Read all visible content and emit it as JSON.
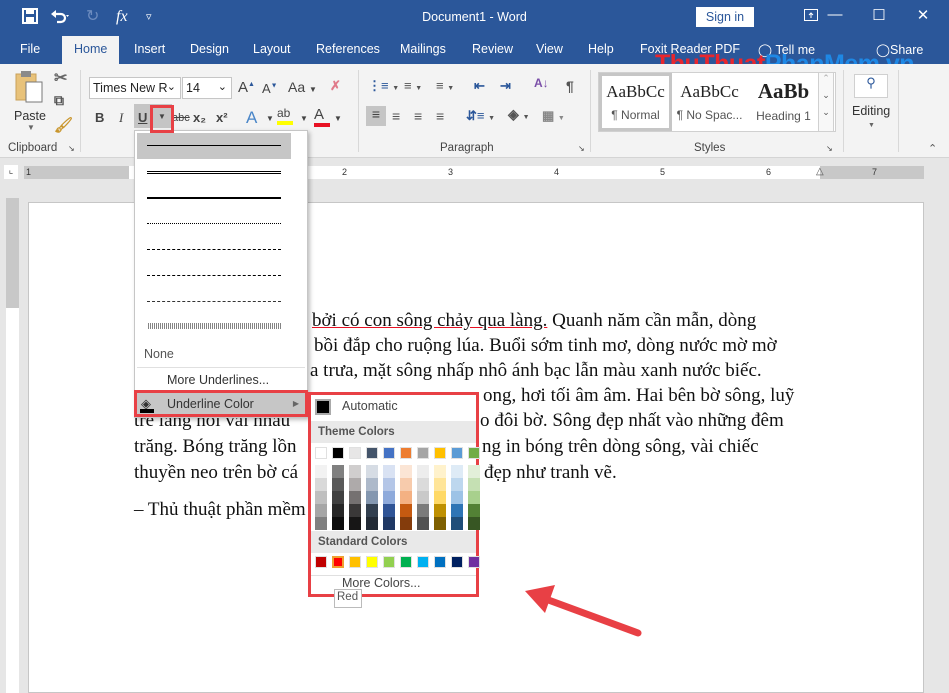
{
  "window": {
    "title": "Document1  -  Word",
    "sign_in": "Sign in"
  },
  "qat": {
    "save_icon": "save-icon",
    "undo_icon": "undo-icon",
    "redo_icon": "redo-icon",
    "formula_icon": "fx",
    "customize_icon": "customize-icon"
  },
  "tabs": [
    "File",
    "Home",
    "Insert",
    "Design",
    "Layout",
    "References",
    "Mailings",
    "Review",
    "View",
    "Help",
    "Foxit Reader PDF",
    "Tell me",
    "Share"
  ],
  "active_tab": "Home",
  "ribbon": {
    "clipboard": {
      "label": "Clipboard",
      "paste": "Paste"
    },
    "font": {
      "name": "Times New R",
      "size": "14",
      "grow": "A",
      "shrink": "A",
      "case": "Aa",
      "bold": "B",
      "italic": "I",
      "underline": "U",
      "strike": "abc",
      "subscript": "x₂",
      "superscript": "x²",
      "effects": "A",
      "highlight": "ab",
      "font_color": "A",
      "highlight_color": "#ffff00",
      "font_color_value": "#e81123"
    },
    "paragraph": {
      "label": "Paragraph",
      "show_marks": "¶"
    },
    "styles": {
      "label": "Styles",
      "items": [
        {
          "preview": "AaBbCc",
          "name": "¶ Normal"
        },
        {
          "preview": "AaBbCc",
          "name": "¶ No Spac..."
        },
        {
          "preview": "AaBb",
          "name": "Heading 1"
        }
      ]
    },
    "editing": {
      "label": "Editing"
    }
  },
  "ruler": {
    "numbers": [
      "1",
      "1",
      "2",
      "3",
      "4",
      "5",
      "6",
      "7"
    ]
  },
  "watermark": {
    "part1": "ThuThuat",
    "part2": "PhanMem",
    "part3": ".vn"
  },
  "document": {
    "lines": [
      {
        "text_underlined": "bởi có con sông chảy qua làng.",
        "text_rest": " Quanh năm cần mẫn, dòng"
      },
      {
        "text": "bồi đắp cho ruộng lúa. Buổi sớm tinh mơ, dòng nước mờ mờ"
      },
      {
        "text": "a trưa, mặt sông nhấp nhô ánh bạc lẫn màu xanh nước biếc."
      },
      {
        "text": "ong, hơi tối âm âm. Hai bên bờ sông, luỹ"
      },
      {
        "text_left": "tre làng nối vai nhau",
        "text": "o đôi bờ. Sông đẹp nhất vào những đêm"
      },
      {
        "text_left": "trăng. Bóng trăng lồn",
        "text": "ng in bóng trên dòng sông, vài chiếc"
      },
      {
        "text_left": "thuyền neo trên bờ cá",
        "text": "đẹp như tranh vẽ."
      },
      {
        "text_left": "– Thủ thuật phần mềm"
      }
    ]
  },
  "underline_menu": {
    "styles": [
      "single",
      "double",
      "thick",
      "dotted",
      "dashed",
      "dash-dot",
      "dash-dot-dot",
      "wave"
    ],
    "none": "None",
    "more": "More Underlines...",
    "color": "Underline Color"
  },
  "color_panel": {
    "automatic": "Automatic",
    "theme_header": "Theme Colors",
    "theme_top": [
      "#ffffff",
      "#000000",
      "#e7e6e6",
      "#44546a",
      "#4472c4",
      "#ed7d31",
      "#a5a5a5",
      "#ffc000",
      "#5b9bd5",
      "#70ad47"
    ],
    "theme_shades": [
      [
        "#f2f2f2",
        "#d9d9d9",
        "#bfbfbf",
        "#a6a6a6",
        "#808080"
      ],
      [
        "#808080",
        "#595959",
        "#404040",
        "#262626",
        "#0d0d0d"
      ],
      [
        "#d0cece",
        "#aeaaaa",
        "#757171",
        "#3a3838",
        "#171616"
      ],
      [
        "#d6dce4",
        "#adb9ca",
        "#8497b0",
        "#323f4f",
        "#222a35"
      ],
      [
        "#d9e2f3",
        "#b4c6e7",
        "#8eaadb",
        "#2f5496",
        "#1f3864"
      ],
      [
        "#fbe5d5",
        "#f7cbac",
        "#f4b183",
        "#c55a11",
        "#843c0c"
      ],
      [
        "#ededed",
        "#dbdbdb",
        "#c9c9c9",
        "#7b7b7b",
        "#525252"
      ],
      [
        "#fff2cc",
        "#ffe599",
        "#ffd966",
        "#bf9000",
        "#7f6000"
      ],
      [
        "#deebf6",
        "#bdd7ee",
        "#9dc3e6",
        "#2e75b5",
        "#1f4e79"
      ],
      [
        "#e2efd9",
        "#c5e0b3",
        "#a8d08d",
        "#538135",
        "#375623"
      ]
    ],
    "standard_header": "Standard Colors",
    "standard": [
      "#c00000",
      "#ff0000",
      "#ffc000",
      "#ffff00",
      "#92d050",
      "#00b050",
      "#00b0f0",
      "#0070c0",
      "#002060",
      "#7030a0"
    ],
    "selected_standard": "#ff0000",
    "more": "More Colors...",
    "tooltip": "Red"
  },
  "highlight_color": "#e84045"
}
